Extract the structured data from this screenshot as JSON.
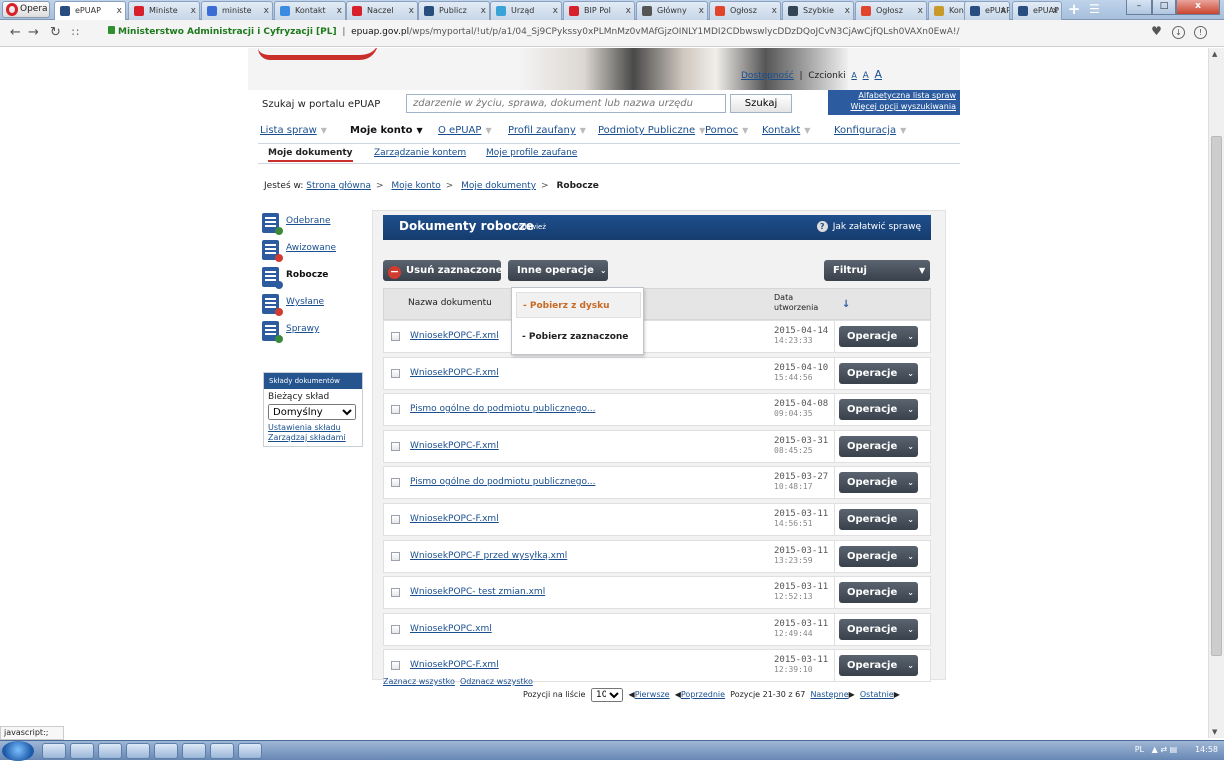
{
  "browser": {
    "menu_label": "Opera",
    "tabs": [
      {
        "label": "ePUAP",
        "color": "#2a4d7f"
      },
      {
        "label": "Ministe",
        "color": "#d8202b"
      },
      {
        "label": "ministe",
        "color": "#3b6cd6"
      },
      {
        "label": "Kontakt",
        "color": "#3b8be0"
      },
      {
        "label": "Naczel",
        "color": "#d8202b"
      },
      {
        "label": "Publicz",
        "color": "#2a4d7f"
      },
      {
        "label": "Urząd",
        "color": "#3aa3d8"
      },
      {
        "label": "BIP Pol",
        "color": "#d8202b"
      },
      {
        "label": "Główny",
        "color": "#555555"
      },
      {
        "label": "Ogłosz",
        "color": "#e1432c"
      },
      {
        "label": "Szybkie",
        "color": "#334455"
      },
      {
        "label": "Ogłosz",
        "color": "#e1432c"
      },
      {
        "label": "Kontakt",
        "color": "#c89a2a"
      },
      {
        "label": "ePUAP",
        "color": "#2a4d7f"
      },
      {
        "label": "ePUAP",
        "color": "#2a4d7f"
      }
    ],
    "site_identity": "Ministerstwo Administracji i Cyfryzacji [PL]",
    "url_host": "epuap.gov.pl",
    "url_path": "/wps/myportal/!ut/p/a1/04_Sj9CPykssy0xPLMnMz0vMAfGjzOINLY1MDI2CDbwswlycDDzDQoJCvN3CjAwCjfQLsh0VAXn0EwA!/",
    "status_text": "javascript:;"
  },
  "header": {
    "accessibility_label": "Dostępność",
    "fonts_label": "Czcionki",
    "font_sizes": [
      "A",
      "A",
      "A"
    ],
    "search_label": "Szukaj w portalu ePUAP",
    "search_placeholder": "zdarzenie w życiu, sprawa, dokument lub nazwa urzędu",
    "search_button": "Szukaj",
    "alpha_list_link": "Alfabetyczna lista spraw",
    "more_search_link": "Więcej opcji wyszukiwania"
  },
  "nav": {
    "items": [
      "Lista spraw",
      "Moje konto",
      "O ePUAP",
      "Profil zaufany",
      "Podmioty Publiczne",
      "Pomoc",
      "Kontakt",
      "Konfiguracja"
    ],
    "active": "Moje konto",
    "sub_items": [
      "Moje dokumenty",
      "Zarządzanie kontem",
      "Moje profile zaufane"
    ]
  },
  "breadcrumb": {
    "prefix": "Jesteś w:",
    "items": [
      "Strona główna",
      "Moje konto",
      "Moje dokumenty"
    ],
    "current": "Robocze"
  },
  "sidebar": {
    "items": [
      {
        "label": "Odebrane",
        "badge_color": "#3a8a3a"
      },
      {
        "label": "Awizowane",
        "badge_color": "#d23b2f"
      },
      {
        "label": "Robocze",
        "badge_color": "#2c5c9f"
      },
      {
        "label": "Wysłane",
        "badge_color": "#d23b2f"
      },
      {
        "label": "Sprawy",
        "badge_color": "#3a8a3a"
      }
    ],
    "active": "Robocze",
    "storage": {
      "title": "Składy dokumentów",
      "current_label": "Bieżący skład",
      "selected": "Domyślny",
      "settings_link": "Ustawienia składu",
      "manage_link": "Zarządzaj składami"
    }
  },
  "panel": {
    "title": "Dokumenty robocze",
    "refresh": "odśwież",
    "help": "Jak załatwić sprawę",
    "delete_button": "Usuń zaznaczone",
    "other_ops_button": "Inne operacje",
    "filter_button": "Filtruj",
    "col_name": "Nazwa dokumentu",
    "col_date_1": "Data",
    "col_date_2": "utworzenia",
    "row_op_label": "Operacje",
    "dropdown": [
      "- Pobierz z dysku",
      "- Pobierz zaznaczone"
    ],
    "rows": [
      {
        "name": "WniosekPOPC-F.xml",
        "date": "2015-04-14",
        "time": "14:23:33"
      },
      {
        "name": "WniosekPOPC-F.xml",
        "date": "2015-04-10",
        "time": "15:44:56"
      },
      {
        "name": "Pismo ogólne do podmiotu publicznego...",
        "date": "2015-04-08",
        "time": "09:04:35"
      },
      {
        "name": "WniosekPOPC-F.xml",
        "date": "2015-03-31",
        "time": "08:45:25"
      },
      {
        "name": "Pismo ogólne do podmiotu publicznego...",
        "date": "2015-03-27",
        "time": "10:48:17"
      },
      {
        "name": "WniosekPOPC-F.xml",
        "date": "2015-03-11",
        "time": "14:56:51"
      },
      {
        "name": "WniosekPOPC-F przed wysyłką.xml",
        "date": "2015-03-11",
        "time": "13:23:59"
      },
      {
        "name": "WniosekPOPC- test zmian.xml",
        "date": "2015-03-11",
        "time": "12:52:13"
      },
      {
        "name": "WniosekPOPC.xml",
        "date": "2015-03-11",
        "time": "12:49:44"
      },
      {
        "name": "WniosekPOPC-F.xml",
        "date": "2015-03-11",
        "time": "12:39:10"
      }
    ],
    "select_all": "Zaznacz wszystko",
    "deselect_all": "Odznacz wszystko",
    "pager": {
      "per_page_label": "Pozycji na liście",
      "per_page": "10",
      "first": "Pierwsze",
      "prev": "Poprzednie",
      "range": "Pozycje 21-30 z 67",
      "next": "Następne",
      "last": "Ostatnie"
    }
  },
  "taskbar": {
    "lang": "PL",
    "clock": "14:58"
  }
}
